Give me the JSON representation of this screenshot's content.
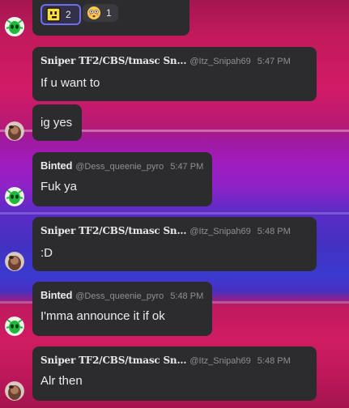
{
  "reactions": [
    {
      "icon": "square-face-emoji-icon",
      "count": "2",
      "active": true
    },
    {
      "icon": "flushed-face-emoji-icon",
      "count": "1",
      "active": false
    }
  ],
  "messages": [
    {
      "author": "Sniper TF2/CBS/tmasc Sn...",
      "handle": "@Itz_Snipah69",
      "time": "5:47 PM",
      "text": "If u want to",
      "header": true
    },
    {
      "author": "",
      "handle": "",
      "time": "",
      "text": "ig yes",
      "header": false
    },
    {
      "author": "Binted",
      "handle": "@Dess_queenie_pyro",
      "time": "5:47 PM",
      "text": "Fuk ya",
      "header": true
    },
    {
      "author": "Sniper TF2/CBS/tmasc Sn...",
      "handle": "@Itz_Snipah69",
      "time": "5:48 PM",
      "text": ":D",
      "header": true
    },
    {
      "author": "Binted",
      "handle": "@Dess_queenie_pyro",
      "time": "5:48 PM",
      "text": "I'mma announce it if ok",
      "header": true
    },
    {
      "author": "Sniper TF2/CBS/tmasc Sn...",
      "handle": "@Itz_Snipah69",
      "time": "5:48 PM",
      "text": "Alr then",
      "header": true
    }
  ],
  "colors": {
    "bubble": "#2c2c2f",
    "reaction_active_border": "#6f6cf0",
    "green_avatar": "#20c040"
  }
}
